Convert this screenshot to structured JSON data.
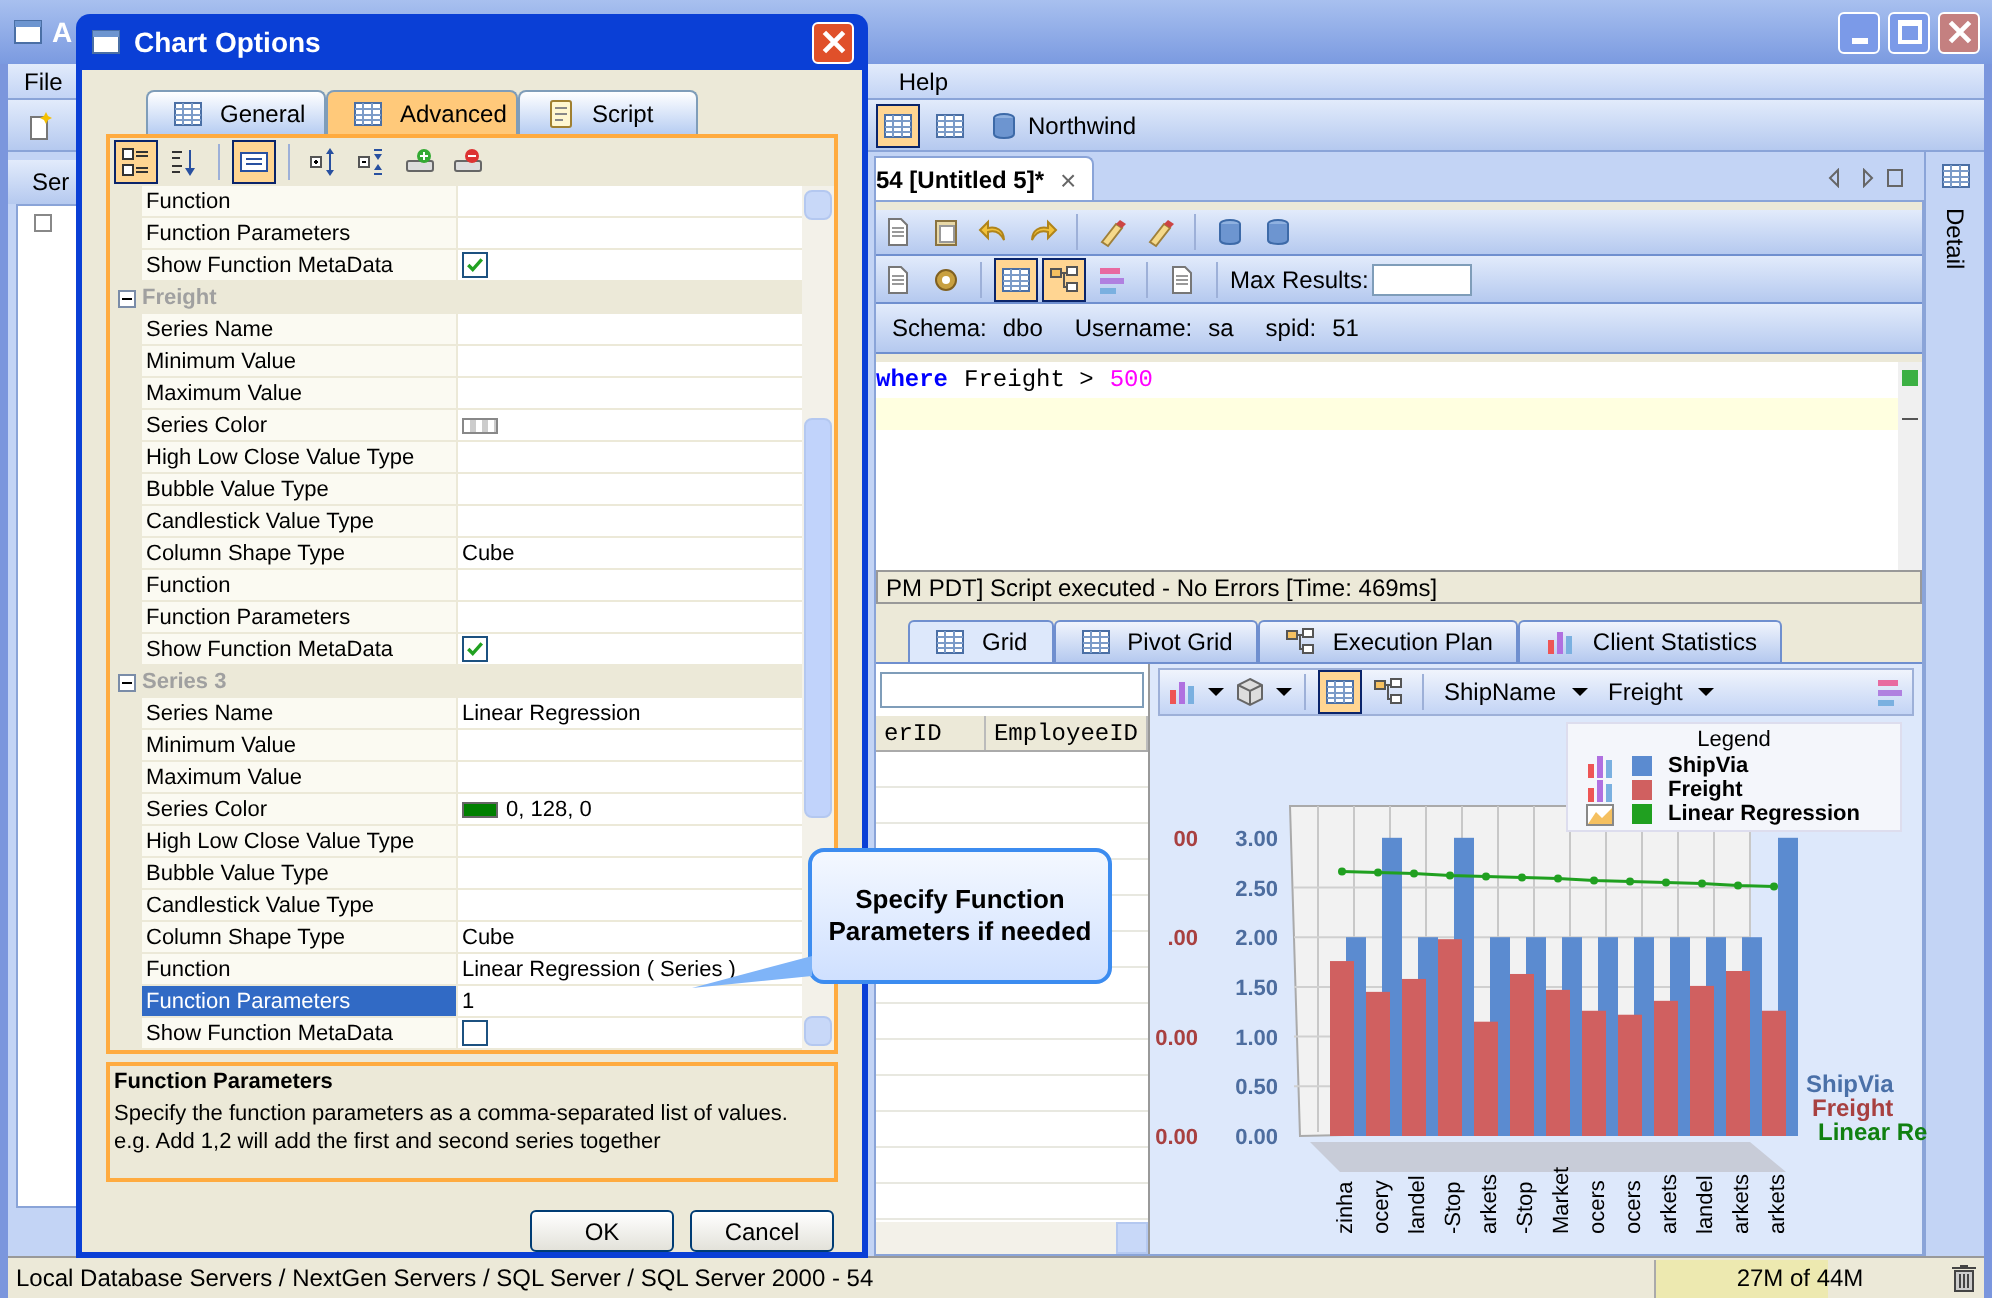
{
  "window": {
    "title": "A"
  },
  "menu": [
    "File",
    "Help"
  ],
  "toolbar": {
    "connection": "Northwind"
  },
  "left_panel": {
    "title": "Ser"
  },
  "editor_tab": {
    "title": "54 [Untitled 5]*",
    "close": "×"
  },
  "side_panel": {
    "title": "Detail"
  },
  "query_toolbar": {
    "max_results_label": "Max Results:"
  },
  "connection_info": [
    {
      "label": "Schema:",
      "value": "dbo"
    },
    {
      "label": "Username:",
      "value": "sa"
    },
    {
      "label": "spid:",
      "value": "51"
    }
  ],
  "editor": {
    "code": [
      {
        "kind": "keyword",
        "text": "where"
      },
      {
        "kind": "plain",
        "text": "Freight >"
      },
      {
        "kind": "number",
        "text": "500"
      }
    ]
  },
  "message": "PM PDT] Script executed - No Errors [Time: 469ms]",
  "result_tabs": [
    {
      "label": "Grid",
      "selected": true
    },
    {
      "label": "Pivot Grid",
      "selected": false
    },
    {
      "label": "Execution Plan",
      "selected": false
    },
    {
      "label": "Client Statistics",
      "selected": false
    }
  ],
  "grid": {
    "columns": [
      "erID",
      "EmployeeID"
    ]
  },
  "chart_toolbar": {
    "x_field": "ShipName",
    "y_field": "Freight"
  },
  "chart": {
    "legend_title": "Legend",
    "secondary_axis_labels": [
      "00",
      ".00",
      "0.00",
      "0.00"
    ],
    "series_labels": [
      {
        "text": "ShipVia",
        "color": "#4a70a8"
      },
      {
        "text": "Freight",
        "color": "#a84040"
      },
      {
        "text": "Linear Re",
        "color": "#108010"
      }
    ],
    "chart_data": {
      "type": "bar",
      "categories": [
        "zinha",
        "ocery",
        "landel",
        "-Stop",
        "arkets",
        "-Stop",
        "Market",
        "ocers",
        "ocers",
        "arkets",
        "landel",
        "arkets",
        "arkets"
      ],
      "ylim": [
        0,
        3
      ],
      "grid": true,
      "legend": "upper right",
      "yticks": [
        {
          "value": 0,
          "label": "0.00"
        },
        {
          "value": 0.5,
          "label": "0.50"
        },
        {
          "value": 1,
          "label": "1.00"
        },
        {
          "value": 1.5,
          "label": "1.50"
        },
        {
          "value": 2,
          "label": "2.00"
        },
        {
          "value": 2.5,
          "label": "2.50"
        },
        {
          "value": 3,
          "label": "3.00"
        }
      ],
      "series": [
        {
          "name": "ShipVia",
          "color": "#5b8bd0",
          "values": [
            2,
            3,
            2,
            3,
            2,
            2,
            2,
            2,
            2,
            2,
            2,
            2,
            3
          ]
        },
        {
          "name": "Freight",
          "color": "#d06060",
          "values": [
            1.76,
            1.45,
            1.58,
            1.98,
            1.15,
            1.63,
            1.47,
            1.26,
            1.22,
            1.36,
            1.51,
            1.66,
            1.26
          ]
        },
        {
          "name": "Linear Regression",
          "color": "#20a020",
          "type": "line",
          "marker": "o",
          "values": [
            2.66,
            2.65,
            2.64,
            2.62,
            2.61,
            2.6,
            2.59,
            2.57,
            2.56,
            2.55,
            2.54,
            2.52,
            2.51
          ]
        }
      ]
    }
  },
  "status_bar": {
    "path": "Local Database Servers / NextGen Servers / SQL Server / SQL Server 2000 - 54",
    "memory": {
      "text": "27M of 44M",
      "level": 0.6
    }
  },
  "dialog": {
    "title": "Chart Options",
    "tabs": [
      {
        "label": "General",
        "selected": false
      },
      {
        "label": "Advanced",
        "selected": true
      },
      {
        "label": "Script",
        "selected": false
      }
    ],
    "toolbar": [
      {
        "kind": "categorized",
        "selected": true
      },
      {
        "kind": "alphabetical",
        "selected": false
      },
      {
        "kind": "description",
        "selected": true
      }
    ],
    "rows": [
      {
        "kind": "text",
        "name": "Function",
        "selected": false
      },
      {
        "kind": "text",
        "name": "Function Parameters",
        "selected": false
      },
      {
        "kind": "check",
        "name": "Show Function MetaData",
        "checked": true,
        "selected": false
      },
      {
        "kind": "category",
        "name": "Freight",
        "expanded": true
      },
      {
        "kind": "text",
        "name": "Series Name",
        "selected": false
      },
      {
        "kind": "text",
        "name": "Minimum Value",
        "selected": false
      },
      {
        "kind": "text",
        "name": "Maximum Value",
        "selected": false
      },
      {
        "kind": "pattern",
        "name": "Series Color",
        "selected": false
      },
      {
        "kind": "text",
        "name": "High Low Close Value Type",
        "selected": false
      },
      {
        "kind": "text",
        "name": "Bubble Value Type",
        "selected": false
      },
      {
        "kind": "text",
        "name": "Candlestick Value Type",
        "selected": false
      },
      {
        "kind": "text",
        "name": "Column Shape Type",
        "value": "Cube",
        "selected": false
      },
      {
        "kind": "text",
        "name": "Function",
        "selected": false
      },
      {
        "kind": "text",
        "name": "Function Parameters",
        "selected": false
      },
      {
        "kind": "check",
        "name": "Show Function MetaData",
        "checked": true,
        "selected": false
      },
      {
        "kind": "category",
        "name": "Series 3",
        "expanded": true
      },
      {
        "kind": "text",
        "name": "Series Name",
        "value": "Linear Regression",
        "selected": false
      },
      {
        "kind": "text",
        "name": "Minimum Value",
        "selected": false
      },
      {
        "kind": "text",
        "name": "Maximum Value",
        "selected": false
      },
      {
        "kind": "color",
        "name": "Series Color",
        "value": "0, 128, 0",
        "color": "#008000",
        "selected": false
      },
      {
        "kind": "text",
        "name": "High Low Close Value Type",
        "selected": false
      },
      {
        "kind": "text",
        "name": "Bubble Value Type",
        "selected": false
      },
      {
        "kind": "text",
        "name": "Candlestick Value Type",
        "selected": false
      },
      {
        "kind": "text",
        "name": "Column Shape Type",
        "value": "Cube",
        "selected": false
      },
      {
        "kind": "text",
        "name": "Function",
        "value": "Linear Regression ( Series )",
        "selected": false
      },
      {
        "kind": "text",
        "name": "Function Parameters",
        "value": "1",
        "selected": true
      },
      {
        "kind": "check",
        "name": "Show Function MetaData",
        "checked": false,
        "selected": false
      }
    ],
    "description": {
      "title": "Function Parameters",
      "text": "Specify the function parameters as a comma-separated list of values.  e.g. Add 1,2 will add the first and second series together"
    },
    "buttons": [
      "OK",
      "Cancel"
    ]
  },
  "callout": {
    "text": "Specify Function Parameters if needed"
  }
}
